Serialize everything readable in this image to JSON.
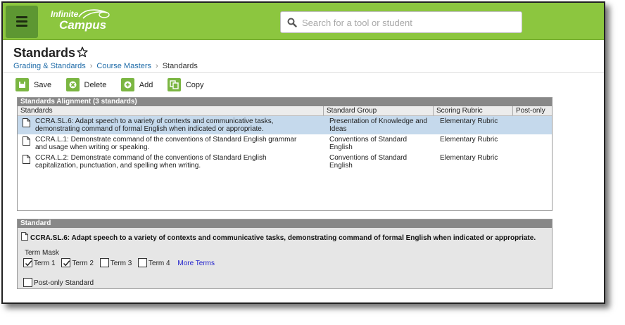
{
  "header": {
    "logo_line1": "Infinite",
    "logo_line2": "Campus",
    "search_placeholder": "Search for a tool or student"
  },
  "page": {
    "title": "Standards",
    "breadcrumbs": [
      "Grading & Standards",
      "Course Masters",
      "Standards"
    ]
  },
  "toolbar": {
    "save_label": "Save",
    "delete_label": "Delete",
    "add_label": "Add",
    "copy_label": "Copy"
  },
  "alignment": {
    "title": "Standards Alignment (3 standards)",
    "columns": [
      "Standards",
      "Standard Group",
      "Scoring Rubric",
      "Post-only"
    ],
    "rows": [
      {
        "standard_l1": "CCRA.SL.6: Adapt speech to a variety of contexts and communicative tasks,",
        "standard_l2": "demonstrating command of formal English when indicated or appropriate.",
        "group_l1": "Presentation of Knowledge and",
        "group_l2": "Ideas",
        "rubric": "Elementary Rubric",
        "post_only": ""
      },
      {
        "standard_l1": "CCRA.L.1: Demonstrate command of the conventions of Standard English grammar",
        "standard_l2": "and usage when writing or speaking.",
        "group_l1": "Conventions of Standard",
        "group_l2": "English",
        "rubric": "Elementary Rubric",
        "post_only": ""
      },
      {
        "standard_l1": "CCRA.L.2: Demonstrate command of the conventions of Standard English",
        "standard_l2": "capitalization, punctuation, and spelling when writing.",
        "group_l1": "Conventions of Standard",
        "group_l2": "English",
        "rubric": "Elementary Rubric",
        "post_only": ""
      }
    ]
  },
  "standard_detail": {
    "title": "Standard",
    "text": "CCRA.SL.6: Adapt speech to a variety of contexts and communicative tasks, demonstrating command of formal English when indicated or appropriate.",
    "term_mask_label": "Term Mask",
    "terms": [
      {
        "label": "Term 1",
        "checked": true
      },
      {
        "label": "Term 2",
        "checked": true
      },
      {
        "label": "Term 3",
        "checked": false
      },
      {
        "label": "Term 4",
        "checked": false
      }
    ],
    "more_terms_label": "More Terms",
    "post_only_label": "Post-only Standard",
    "post_only_checked": false
  },
  "colors": {
    "topbar": "#8cc63f",
    "menu_button": "#5d9732",
    "selected_row": "#c5d9ec",
    "panel_header": "#888888",
    "link": "#1e6ba8"
  }
}
